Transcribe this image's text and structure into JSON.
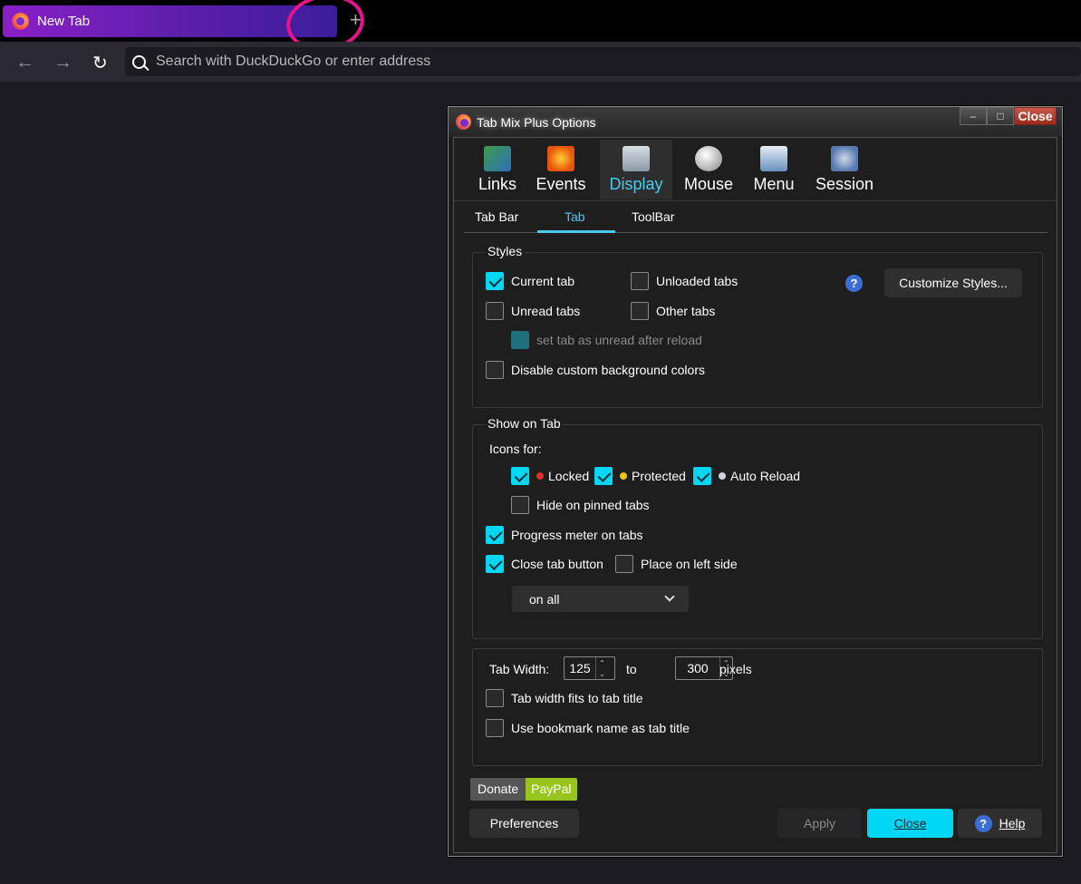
{
  "browser": {
    "tab_title": "New Tab",
    "new_tab": "+",
    "back": "←",
    "forward": "→",
    "reload": "↻",
    "url_placeholder": "Search with DuckDuckGo or enter address"
  },
  "dialog": {
    "title": "Tab Mix Plus Options",
    "min": "‒",
    "max": "□",
    "close": "Close",
    "toolbar": [
      {
        "label": "Links"
      },
      {
        "label": "Events"
      },
      {
        "label": "Display"
      },
      {
        "label": "Mouse"
      },
      {
        "label": "Menu"
      },
      {
        "label": "Session"
      }
    ],
    "subtabs": [
      "Tab Bar",
      "Tab",
      "ToolBar"
    ],
    "styles": {
      "title": "Styles",
      "current_tab": "Current tab",
      "unloaded_tabs": "Unloaded tabs",
      "unread_tabs": "Unread tabs",
      "other_tabs": "Other tabs",
      "set_unread": "set tab as unread after reload",
      "disable_bg": "Disable custom background colors",
      "help": "?",
      "customize": "Customize Styles..."
    },
    "show_on_tab": {
      "title": "Show on Tab",
      "icons_for": "Icons for:",
      "locked": "Locked",
      "protected": "Protected",
      "auto_reload": "Auto Reload",
      "hide_pinned": "Hide on pinned tabs",
      "progress": "Progress meter on tabs",
      "close_btn": "Close tab button",
      "left_side": "Place on left side",
      "close_select": "on all"
    },
    "width": {
      "label": "Tab Width:",
      "min": "125",
      "to": "to",
      "max": "300",
      "unit": "pixels",
      "fits_title": "Tab width fits to tab title",
      "bookmark_name": "Use bookmark name as tab title"
    },
    "donate": "Donate",
    "paypal": "PayPal",
    "preferences": "Preferences",
    "apply": "Apply",
    "help": "Help",
    "help_mark": "?",
    "up": "⌃",
    "down": "⌄"
  }
}
